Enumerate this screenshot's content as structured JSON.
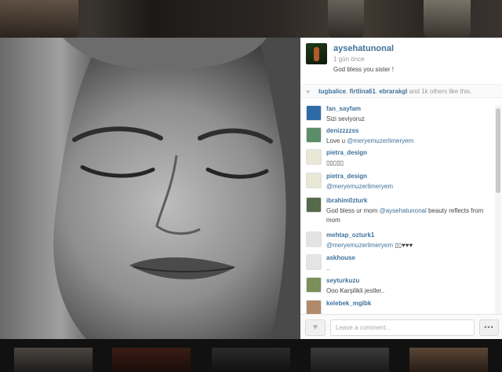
{
  "post": {
    "username": "aysehatunonal",
    "time": "1 gün önce",
    "caption": "God bless you sister !"
  },
  "likes": {
    "users": [
      "tugbalice",
      "firtlina61",
      "ebrarakgl"
    ],
    "sep": ", ",
    "others_text": " and 1k others like this."
  },
  "comments": [
    {
      "user": "fan_sayfam",
      "parts": [
        {
          "t": "Sizi seviyoruz"
        }
      ],
      "avatar": "#2e6aa8"
    },
    {
      "user": "denizzzzss",
      "parts": [
        {
          "t": "Love u "
        },
        {
          "t": "@meryemuzerlimeryem",
          "m": true
        }
      ],
      "avatar": "#5b8d6a"
    },
    {
      "user": "pietra_design",
      "parts": [
        {
          "t": "▯▯▯▯▯"
        }
      ],
      "avatar": "#e9e7d6"
    },
    {
      "user": "pietra_design",
      "parts": [
        {
          "t": "@meryemuzerlimeryem",
          "m": true
        }
      ],
      "avatar": "#e9e7d6"
    },
    {
      "user": "ibrahim0zturk",
      "parts": [
        {
          "t": "God bless ur mom "
        },
        {
          "t": "@aysehatunonal",
          "m": true
        },
        {
          "t": " beauty reflects from mom"
        }
      ],
      "avatar": "#556b4c"
    },
    {
      "user": "mehtap_ozturk1",
      "parts": [
        {
          "t": "@meryemuzerlimeryem",
          "m": true
        },
        {
          "t": " ▯▯♥♥♥"
        }
      ],
      "avatar": "#e4e4e4"
    },
    {
      "user": "askhouse",
      "parts": [
        {
          "t": ".."
        }
      ],
      "avatar": "#e4e4e4"
    },
    {
      "user": "seyturkuzu",
      "parts": [
        {
          "t": "Ooo Karşilikli jestler.."
        }
      ],
      "avatar": "#7a8f5a"
    },
    {
      "user": "kelebek_mglbk",
      "parts": [],
      "avatar": "#b08a6a"
    }
  ],
  "input": {
    "placeholder": "Leave a comment..."
  },
  "buttons": {
    "like_icon": "heart-icon",
    "more_icon": "ellipsis-icon",
    "more_label": "•••",
    "heart": "♥"
  },
  "colors": {
    "link": "#3f729b",
    "text": "#444444",
    "muted": "#999999"
  }
}
